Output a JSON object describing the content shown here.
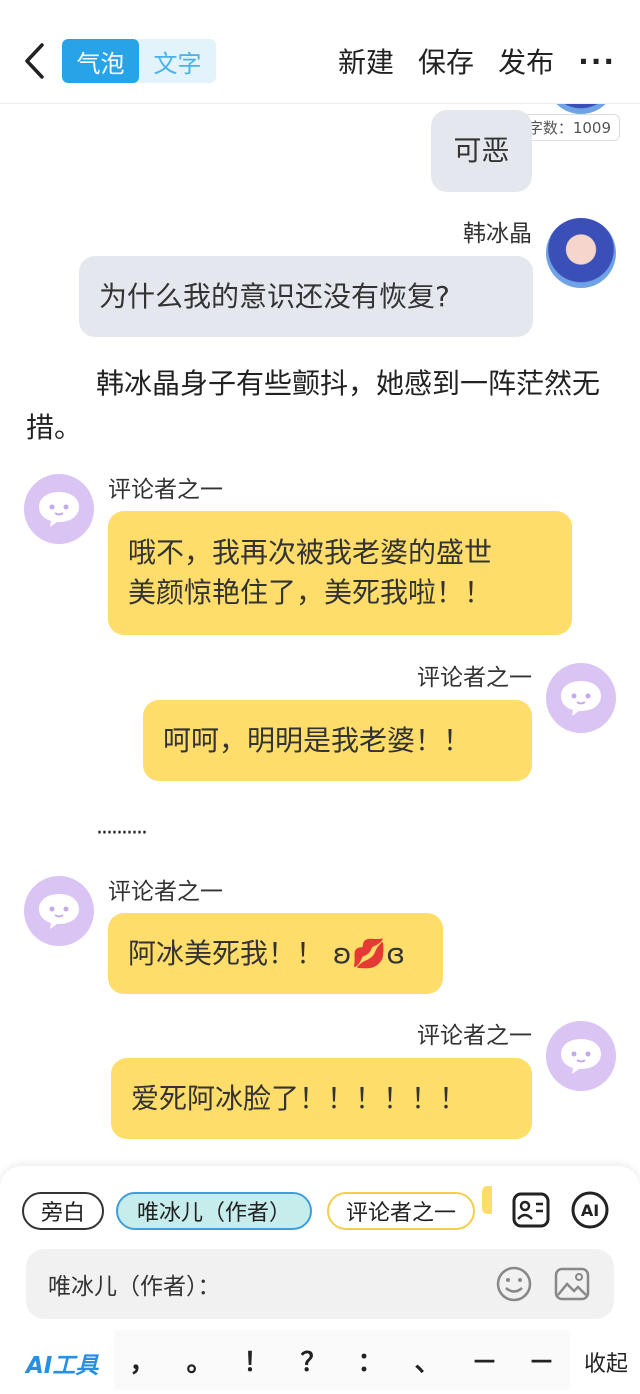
{
  "topbar": {
    "mode_bubble": "气泡",
    "mode_text": "文字",
    "new_label": "新建",
    "save_label": "保存",
    "publish_label": "发布",
    "more_label": "···"
  },
  "word_count": "字数：1009",
  "messages": {
    "m1": {
      "text": "可恶"
    },
    "m2": {
      "speaker": "韩冰晶",
      "text": "为什么我的意识还没有恢复?"
    },
    "narration1": "韩冰晶身子有些颤抖，她感到一阵茫然无措。",
    "m3": {
      "speaker": "评论者之一",
      "text1": "哦不，我再次被我老婆的盛世",
      "text2": "美颜惊艳住了，美死我啦！！"
    },
    "m4": {
      "speaker": "评论者之一",
      "text": "呵呵，明明是我老婆！！"
    },
    "narration2": "··········",
    "m5": {
      "speaker": "评论者之一",
      "text": "阿冰美死我！！ ʚ💋ɞ"
    },
    "m6": {
      "speaker": "评论者之一",
      "text": "爱死阿冰脸了！！！！！！"
    }
  },
  "panel": {
    "chip_narration": "旁白",
    "chip_author": "唯冰儿（作者）",
    "chip_commenter": "评论者之一",
    "ai_label": "AI",
    "input_prefix": "唯冰儿（作者）：",
    "ai_tools": "AI工具",
    "punctuation": [
      "，",
      "。",
      "！",
      "？",
      "：",
      "、",
      "－",
      "－"
    ],
    "collapse": "收起"
  },
  "colors": {
    "accent": "#27a3e8",
    "bubble_yellow": "#fedd6a",
    "bubble_gray": "#e4e8ee",
    "avatar_purple": "#d9c4f3"
  }
}
